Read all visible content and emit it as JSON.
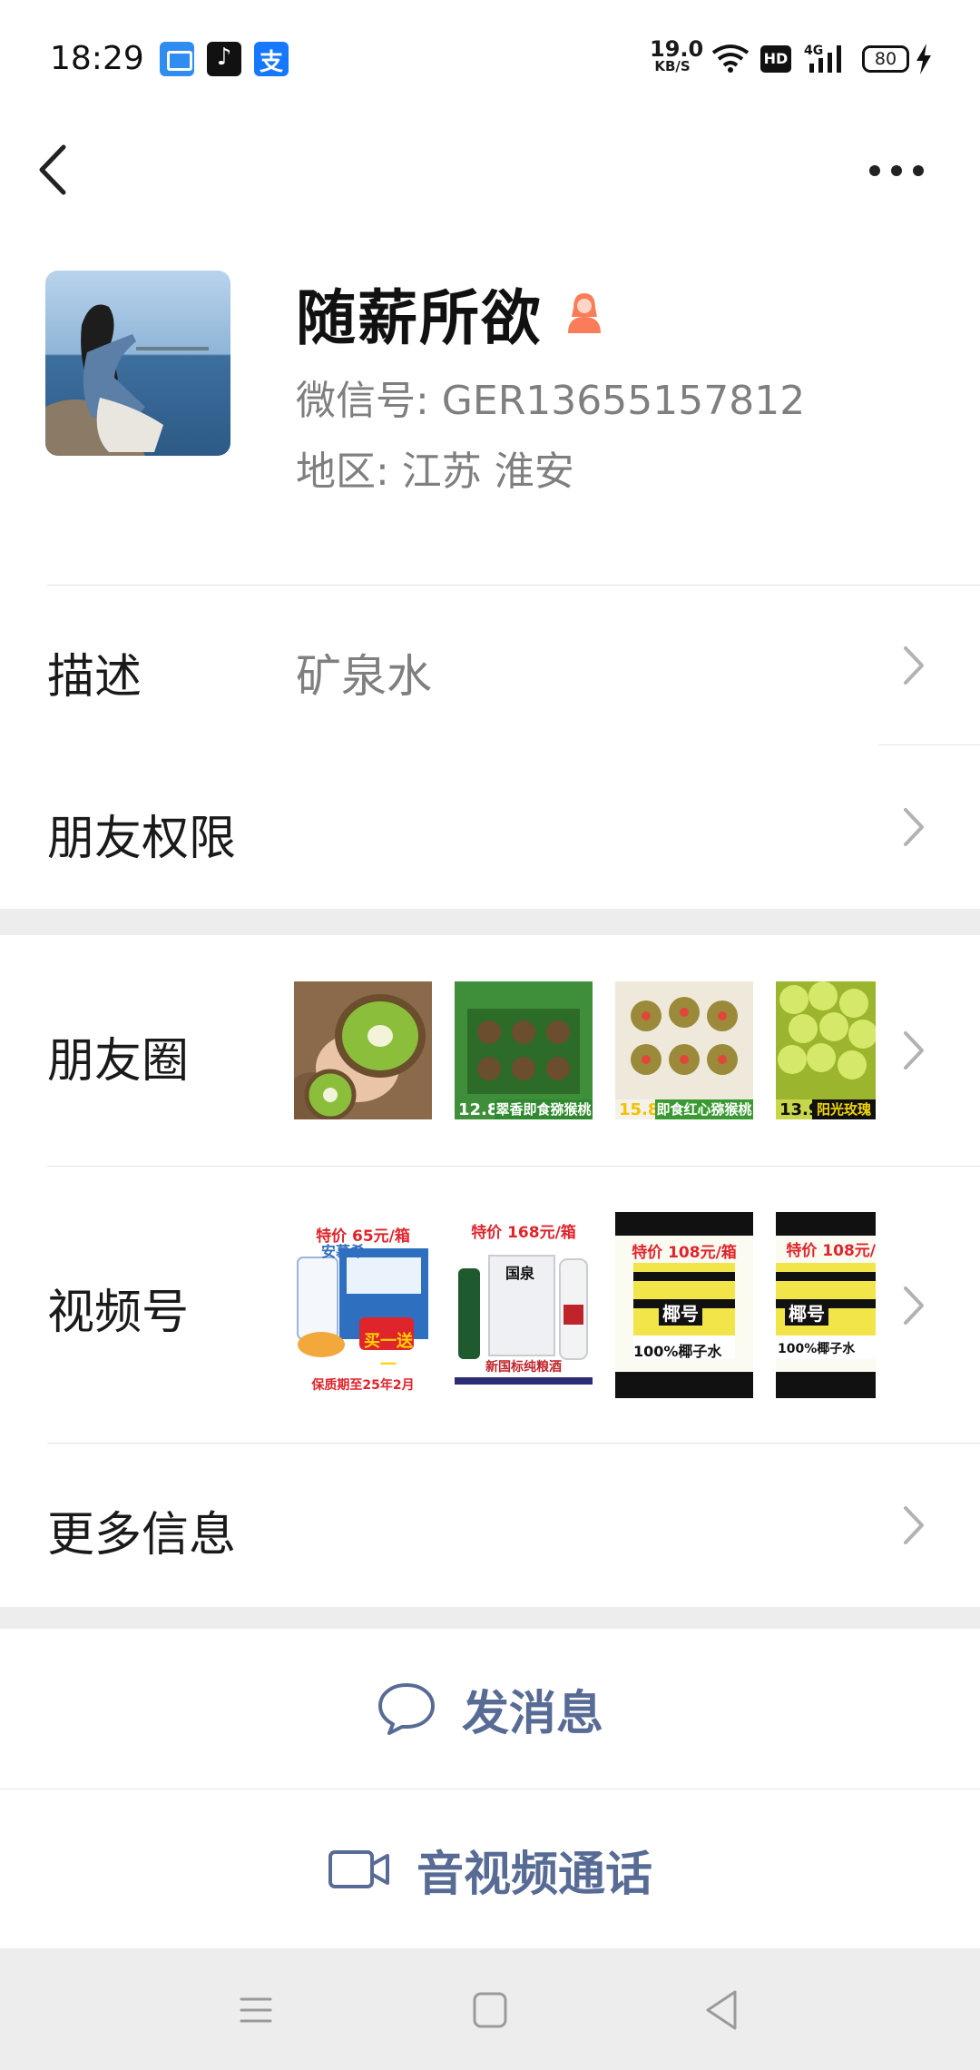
{
  "status_bar": {
    "time": "18:29",
    "network_speed_value": "19.0",
    "network_speed_unit": "KB/S",
    "hd_badge": "HD",
    "signal_label": "4G",
    "battery_level": "80",
    "app_icons": [
      "files-app-icon",
      "tiktok-icon",
      "alipay-icon"
    ]
  },
  "top_bar": {
    "back_icon": "chevron-left-icon",
    "more_icon": "more-dots-icon"
  },
  "profile": {
    "name": "随薪所欲",
    "gender_icon": "female-icon",
    "gender_color": "#fa7d5a",
    "wechat_id": "微信号: GER13655157812",
    "region": "地区: 江苏  淮安"
  },
  "rows": {
    "description": {
      "label": "描述",
      "value": "矿泉水"
    },
    "permissions": {
      "label": "朋友权限"
    },
    "moments": {
      "label": "朋友圈",
      "thumbs": [
        {
          "caption": ""
        },
        {
          "price": "12.8",
          "caption": "翠香即食猕猴桃"
        },
        {
          "price": "15.8",
          "caption": "即食红心猕猴桃"
        },
        {
          "price": "13.9",
          "caption": "阳光玫瑰"
        }
      ]
    },
    "channels": {
      "label": "视频号",
      "thumbs": [
        {
          "top": "特价 65元/箱",
          "mid": "安慕希",
          "badge": "买一送一",
          "bottom": "保质期至25年2月"
        },
        {
          "top": "特价 168元/箱",
          "mid": "国泉",
          "bottom": "新国标纯粮酒"
        },
        {
          "top": "特价 108元/箱",
          "mid": "椰号",
          "bottom": "100%椰子水"
        },
        {
          "top": "特价 108元/",
          "mid": "椰号",
          "bottom": "100%椰子水"
        }
      ]
    },
    "more_info": {
      "label": "更多信息"
    }
  },
  "actions": {
    "message": {
      "label": "发消息",
      "icon": "chat-bubble-icon"
    },
    "call": {
      "label": "音视频通话",
      "icon": "video-camera-icon"
    }
  },
  "colors": {
    "link_blue": "#576b95",
    "secondary_text": "#7f7f7f",
    "background": "#ededed"
  }
}
